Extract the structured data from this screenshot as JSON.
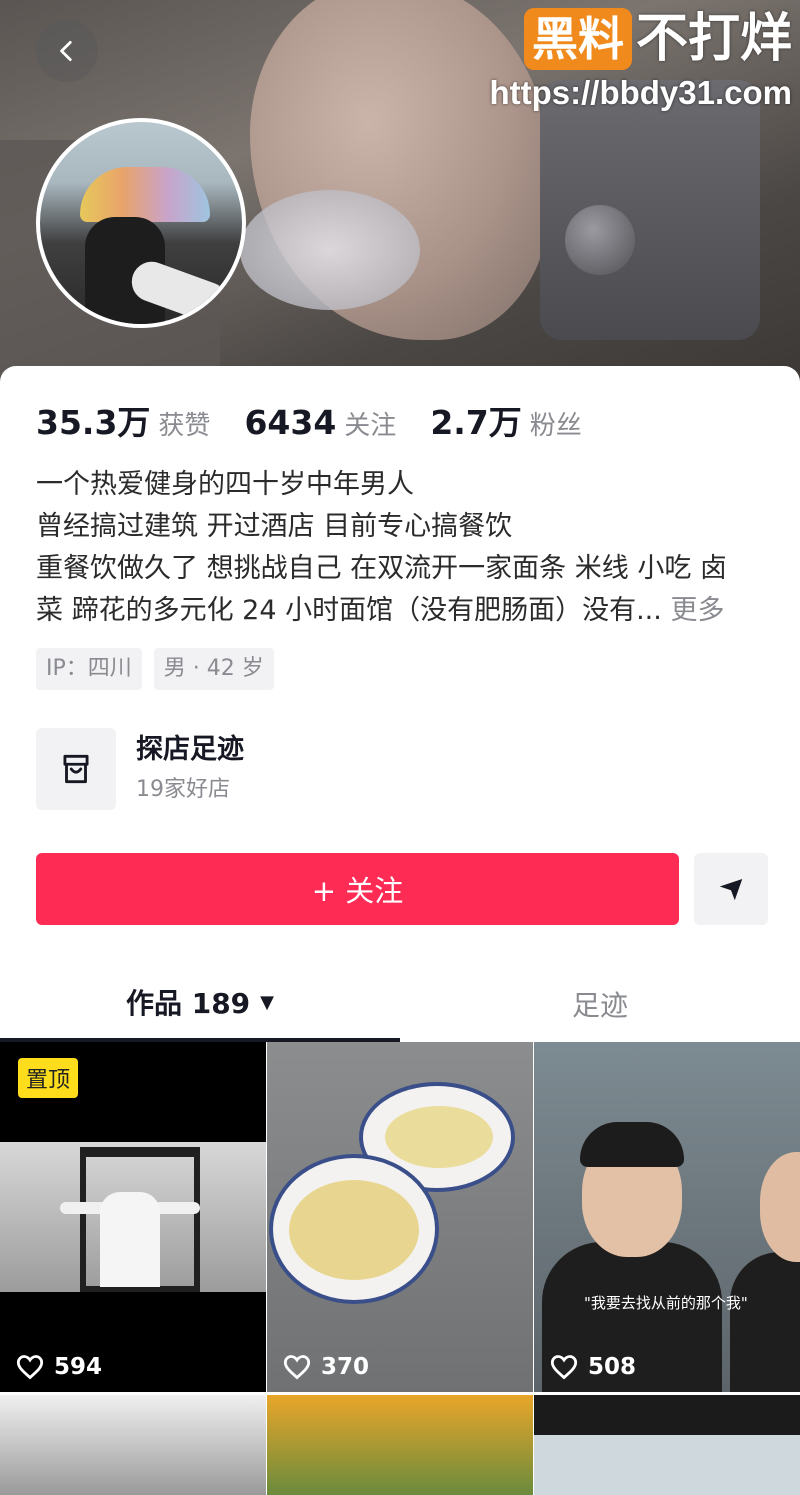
{
  "watermark": {
    "badge": "黑料",
    "text": "不打烊",
    "url": "https://bbdy31.com"
  },
  "profile": {
    "stats": [
      {
        "value": "35.3万",
        "label": "获赞"
      },
      {
        "value": "6434",
        "label": "关注"
      },
      {
        "value": "2.7万",
        "label": "粉丝"
      }
    ],
    "bio_lines": [
      "一个热爱健身的四十岁中年男人",
      "曾经搞过建筑 开过酒店 目前专心搞餐饮",
      "重餐饮做久了 想挑战自己 在双流开一家面条 米线 小吃 卤",
      "菜 蹄花的多元化 24 小时面馆（没有肥肠面）没有..."
    ],
    "bio_more": "更多",
    "tags": [
      "IP：四川",
      "男 · 42 岁"
    ],
    "shop": {
      "title": "探店足迹",
      "subtitle": "19家好店"
    },
    "follow_label": "+ 关注"
  },
  "tabs": {
    "works_label": "作品 189",
    "works_caret": "▼",
    "footprint_label": "足迹"
  },
  "videos": [
    {
      "likes": "594",
      "pinned_label": "置顶"
    },
    {
      "likes": "370"
    },
    {
      "likes": "508",
      "caption": "\"我要去找从前的那个我\""
    }
  ],
  "colors": {
    "follow_button": "#fe2c55",
    "pin_badge": "#ffdd1c",
    "watermark_badge": "#f08a1c"
  },
  "icons": {
    "back": "chevron-left-icon",
    "shop": "store-icon",
    "share": "send-arrow-icon",
    "likes": "heart-outline-icon"
  }
}
